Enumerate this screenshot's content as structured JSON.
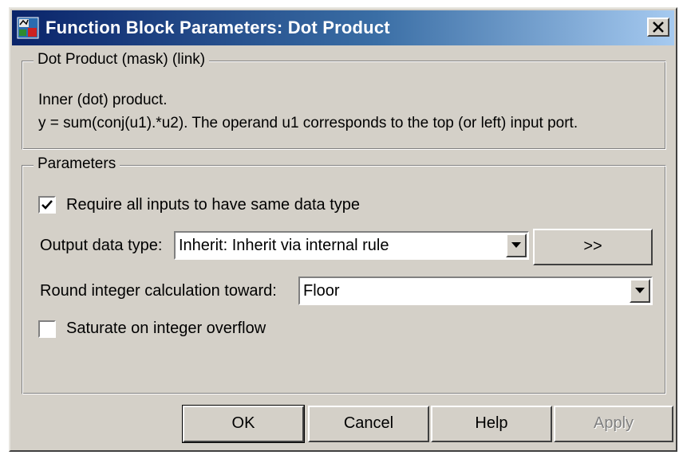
{
  "window": {
    "title": "Function Block Parameters: Dot Product",
    "close_label": "X"
  },
  "mask_group": {
    "title": "Dot Product (mask) (link)",
    "description_line1": "Inner (dot) product.",
    "description_line2": "y = sum(conj(u1).*u2). The operand u1 corresponds to the top (or left) input port."
  },
  "params_group": {
    "title": "Parameters",
    "require_same_type": {
      "label": "Require all inputs to have same data type",
      "checked": true
    },
    "output_data_type": {
      "label": "Output data type:",
      "value": "Inherit: Inherit via internal rule",
      "assistant_button": ">>"
    },
    "round_toward": {
      "label": "Round integer calculation toward:",
      "value": "Floor"
    },
    "saturate": {
      "label": "Saturate on integer overflow",
      "checked": false
    }
  },
  "buttons": {
    "ok": "OK",
    "cancel": "Cancel",
    "help": "Help",
    "apply": "Apply"
  }
}
